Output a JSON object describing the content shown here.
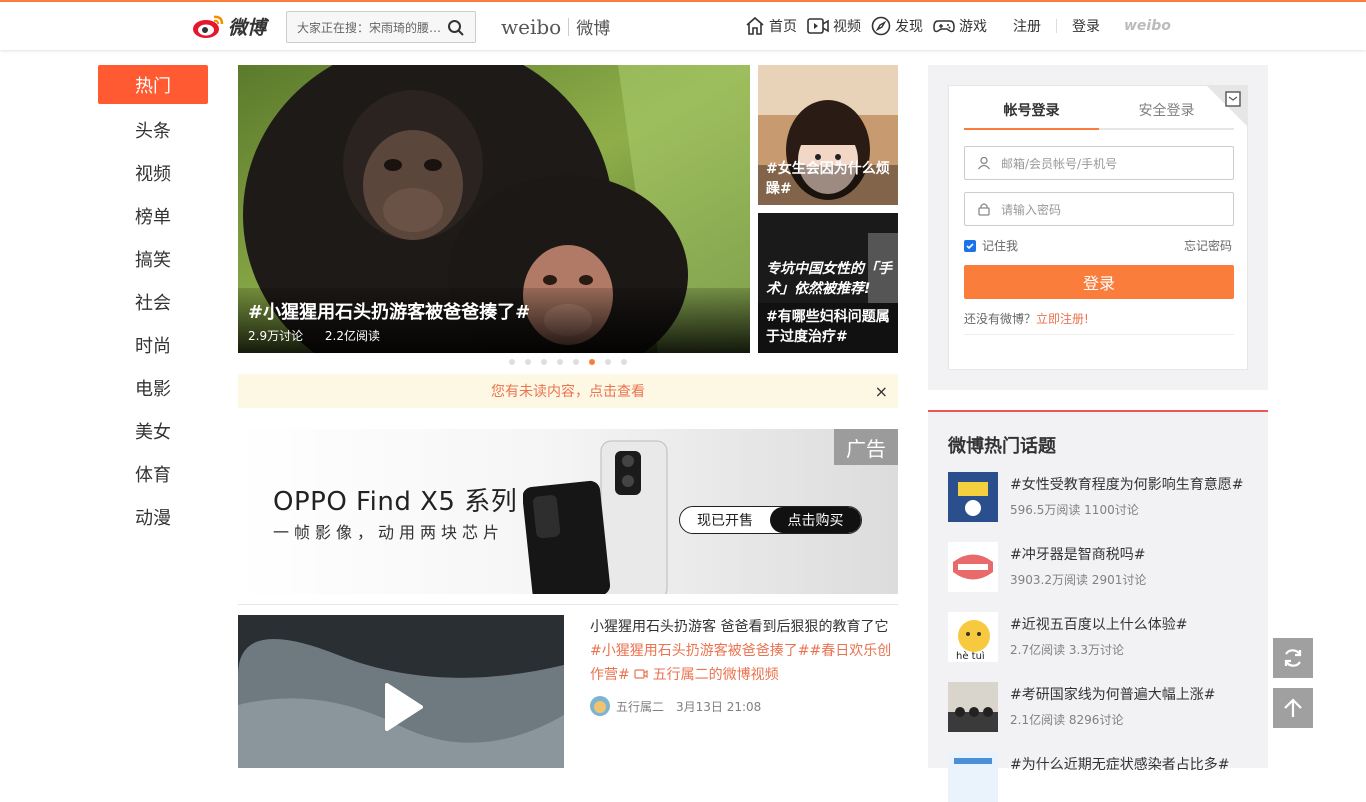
{
  "header": {
    "logo_text": "微博",
    "search_placeholder": "大家正在搜：宋雨琦的腰…",
    "brand_en": "weibo",
    "brand_cn": "微博",
    "nav": [
      {
        "label": "首页",
        "icon": "home-icon"
      },
      {
        "label": "视频",
        "icon": "video-icon"
      },
      {
        "label": "发现",
        "icon": "compass-icon"
      },
      {
        "label": "游戏",
        "icon": "gamepad-icon"
      }
    ],
    "register": "注册",
    "login": "登录",
    "weibo_mark": "weibo"
  },
  "sidebar": {
    "items": [
      "热门",
      "头条",
      "视频",
      "榜单",
      "搞笑",
      "社会",
      "时尚",
      "电影",
      "美女",
      "体育",
      "动漫"
    ],
    "active_index": 0
  },
  "carousel": {
    "main": {
      "title": "#小猩猩用石头扔游客被爸爸揍了#",
      "discuss": "2.9万讨论",
      "read": "2.2亿阅读"
    },
    "side": [
      {
        "caption": "#女生会因为什么烦躁#"
      },
      {
        "caption": "#有哪些妇科问题属于过度治疗#",
        "overlay": "专坑中国女性的「手术」依然被推荐!"
      }
    ],
    "dot_count": 8,
    "active_dot": 5
  },
  "notice": {
    "text": "您有未读内容，点击查看",
    "close": "×"
  },
  "ad": {
    "tag": "广告",
    "title": "OPPO Find X5 系列",
    "subtitle": "一帧影像，动用两块芯片",
    "btn_on_sale": "现已开售",
    "btn_buy": "点击购买"
  },
  "feed": {
    "title": "小猩猩用石头扔游客 爸爸看到后狠狠的教育了它",
    "tags": "#小猩猩用石头扔游客被爸爸揍了##春日欢乐创作营# ",
    "video_link": "五行属二的微博视频",
    "author": "五行属二",
    "date": "3月13日 21:08"
  },
  "login": {
    "tab_account": "帐号登录",
    "tab_secure": "安全登录",
    "username_placeholder": "邮箱/会员帐号/手机号",
    "password_placeholder": "请输入密码",
    "remember": "记住我",
    "forgot": "忘记密码",
    "submit": "登录",
    "no_account": "还没有微博？",
    "register_now": "立即注册!"
  },
  "hot_topics": {
    "title": "微博热门话题",
    "items": [
      {
        "name": "#女性受教育程度为何影响生育意愿#",
        "stats": "596.5万阅读 1100讨论"
      },
      {
        "name": "#冲牙器是智商税吗#",
        "stats": "3903.2万阅读 2901讨论"
      },
      {
        "name": "#近视五百度以上什么体验#",
        "stats": "2.7亿阅读 3.3万讨论"
      },
      {
        "name": "#考研国家线为何普遍大幅上涨#",
        "stats": "2.1亿阅读 8296讨论"
      },
      {
        "name": "#为什么近期无症状感染者占比多#",
        "stats": ""
      }
    ]
  },
  "colors": {
    "accent": "#fa7d3c",
    "sidebar_active": "#ff5a31",
    "link": "#eb7350"
  }
}
